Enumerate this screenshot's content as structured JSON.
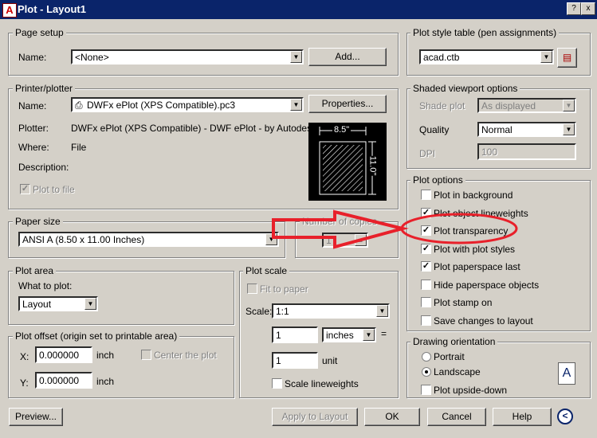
{
  "window": {
    "title": "Plot - Layout1",
    "app_icon": "A",
    "help_button": "?",
    "close_button": "x"
  },
  "page_setup": {
    "legend": "Page setup",
    "name_label": "Name:",
    "name_value": "<None>",
    "add_button": "Add..."
  },
  "printer": {
    "legend": "Printer/plotter",
    "name_label": "Name:",
    "name_value": "DWFx ePlot (XPS Compatible).pc3",
    "properties_button": "Properties...",
    "plotter_label": "Plotter:",
    "plotter_value": "DWFx ePlot (XPS Compatible) - DWF ePlot - by Autodesk",
    "where_label": "Where:",
    "where_value": "File",
    "description_label": "Description:",
    "plot_to_file_label": "Plot to file",
    "preview_width": "8.5\"",
    "preview_height": "11.0\""
  },
  "paper_size": {
    "legend": "Paper size",
    "value": "ANSI A (8.50 x 11.00 Inches)"
  },
  "copies": {
    "legend": "Number of copies",
    "value": "1"
  },
  "plot_area": {
    "legend": "Plot area",
    "what_label": "What to plot:",
    "what_value": "Layout"
  },
  "plot_offset": {
    "legend": "Plot offset (origin set to printable area)",
    "x_label": "X:",
    "x_value": "0.000000",
    "x_unit": "inch",
    "y_label": "Y:",
    "y_value": "0.000000",
    "y_unit": "inch",
    "center_label": "Center the plot"
  },
  "plot_scale": {
    "legend": "Plot scale",
    "fit_label": "Fit to paper",
    "scale_label": "Scale:",
    "scale_value": "1:1",
    "inches_value": "1",
    "inches_unit": "inches",
    "equals": "=",
    "unit_value": "1",
    "unit_label": "unit",
    "scale_lw_label": "Scale lineweights"
  },
  "plot_style": {
    "legend": "Plot style table (pen assignments)",
    "value": "acad.ctb"
  },
  "shaded": {
    "legend": "Shaded viewport options",
    "shade_label": "Shade plot",
    "shade_value": "As displayed",
    "quality_label": "Quality",
    "quality_value": "Normal",
    "dpi_label": "DPI",
    "dpi_value": "100"
  },
  "plot_options": {
    "legend": "Plot options",
    "items": [
      {
        "label": "Plot in background",
        "checked": false
      },
      {
        "label": "Plot object lineweights",
        "checked": true
      },
      {
        "label": "Plot transparency",
        "checked": true
      },
      {
        "label": "Plot with plot styles",
        "checked": true
      },
      {
        "label": "Plot paperspace last",
        "checked": true
      },
      {
        "label": "Hide paperspace objects",
        "checked": false
      },
      {
        "label": "Plot stamp on",
        "checked": false
      },
      {
        "label": "Save changes to layout",
        "checked": false
      }
    ]
  },
  "orientation": {
    "legend": "Drawing orientation",
    "portrait": "Portrait",
    "landscape": "Landscape",
    "upside": "Plot upside-down",
    "preview_letter": "A"
  },
  "buttons": {
    "preview": "Preview...",
    "apply": "Apply to Layout",
    "ok": "OK",
    "cancel": "Cancel",
    "help": "Help",
    "collapse": "<"
  },
  "annotation": {
    "color": "#e8202a"
  }
}
